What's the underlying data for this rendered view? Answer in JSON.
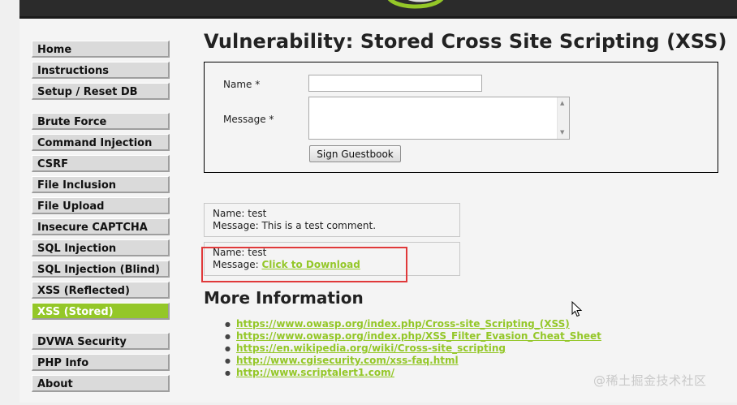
{
  "app": {
    "title": "Vulnerability: Stored Cross Site Scripting (XSS)"
  },
  "menu": {
    "groups": [
      {
        "items": [
          "Home",
          "Instructions",
          "Setup / Reset DB"
        ]
      },
      {
        "items": [
          "Brute Force",
          "Command Injection",
          "CSRF",
          "File Inclusion",
          "File Upload",
          "Insecure CAPTCHA",
          "SQL Injection",
          "SQL Injection (Blind)",
          "XSS (Reflected)",
          "XSS (Stored)"
        ]
      },
      {
        "items": [
          "DVWA Security",
          "PHP Info",
          "About"
        ]
      }
    ],
    "selected": "XSS (Stored)"
  },
  "form": {
    "name_label": "Name *",
    "message_label": "Message *",
    "name_value": "",
    "message_value": "",
    "button_label": "Sign Guestbook"
  },
  "entries": [
    {
      "name_line": "Name: test",
      "message_prefix": "Message: ",
      "message_text": "This is a test comment."
    },
    {
      "name_line": "Name: test",
      "message_prefix": "Message: ",
      "message_link": "Click to Download"
    }
  ],
  "more_info": {
    "title": "More Information",
    "links": [
      "https://www.owasp.org/index.php/Cross-site_Scripting_(XSS)",
      "https://www.owasp.org/index.php/XSS_Filter_Evasion_Cheat_Sheet",
      "https://en.wikipedia.org/wiki/Cross-site_scripting",
      "http://www.cgisecurity.com/xss-faq.html",
      "http://www.scriptalert1.com/"
    ]
  },
  "watermark": "@稀土掘金技术社区",
  "colors": {
    "accent": "#94c728",
    "header": "#2b2b2b",
    "highlight": "#e0393a"
  }
}
